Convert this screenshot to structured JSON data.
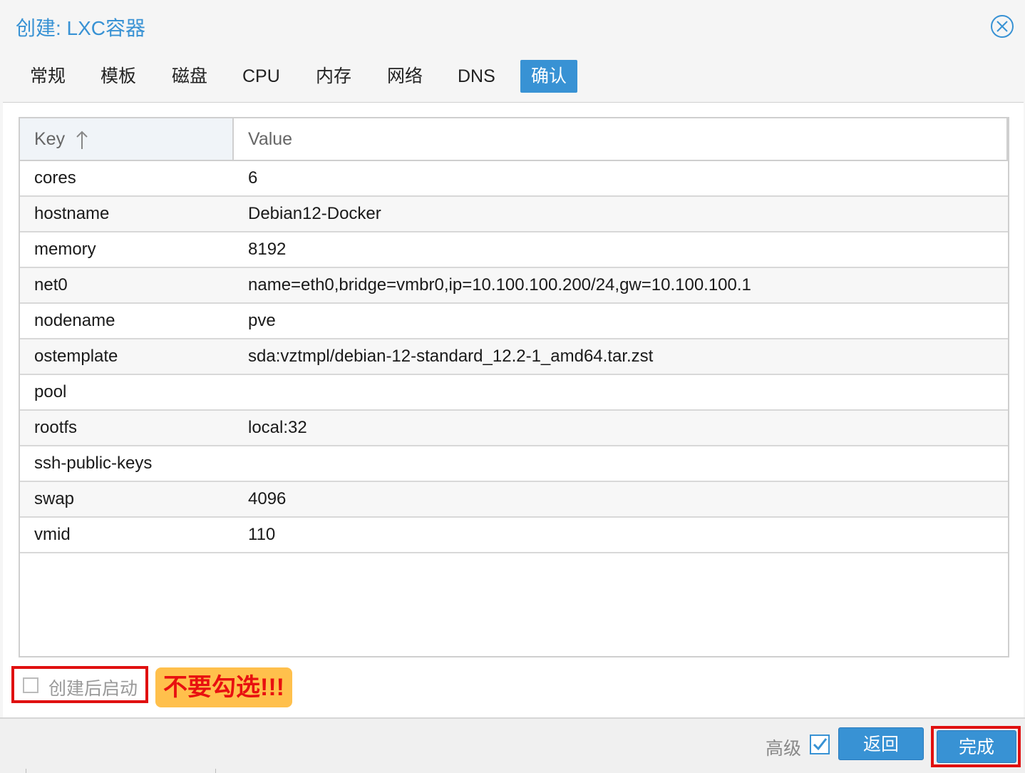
{
  "window": {
    "title": "创建: LXC容器"
  },
  "tabs": [
    {
      "label": "常规"
    },
    {
      "label": "模板"
    },
    {
      "label": "磁盘"
    },
    {
      "label": "CPU"
    },
    {
      "label": "内存"
    },
    {
      "label": "网络"
    },
    {
      "label": "DNS"
    },
    {
      "label": "确认"
    }
  ],
  "active_tab": "确认",
  "grid": {
    "headers": {
      "key": "Key",
      "value": "Value"
    },
    "sort_icon": "arrow-up-icon",
    "rows": [
      {
        "key": "cores",
        "value": "6"
      },
      {
        "key": "hostname",
        "value": "Debian12-Docker"
      },
      {
        "key": "memory",
        "value": "8192"
      },
      {
        "key": "net0",
        "value": "name=eth0,bridge=vmbr0,ip=10.100.100.200/24,gw=10.100.100.1"
      },
      {
        "key": "nodename",
        "value": "pve"
      },
      {
        "key": "ostemplate",
        "value": "sda:vztmpl/debian-12-standard_12.2-1_amd64.tar.zst"
      },
      {
        "key": "pool",
        "value": ""
      },
      {
        "key": "rootfs",
        "value": "local:32"
      },
      {
        "key": "ssh-public-keys",
        "value": ""
      },
      {
        "key": "swap",
        "value": "4096"
      },
      {
        "key": "vmid",
        "value": "110"
      }
    ]
  },
  "options": {
    "start_after_create": {
      "label": "创建后启动",
      "checked": false
    },
    "warning": "不要勾选!!!"
  },
  "footer": {
    "advanced": {
      "label": "高级",
      "checked": true
    },
    "back_label": "返回",
    "finish_label": "完成"
  },
  "colors": {
    "accent": "#3892d4",
    "highlight_red": "#e01010",
    "warning_bg": "#ffc04c"
  }
}
